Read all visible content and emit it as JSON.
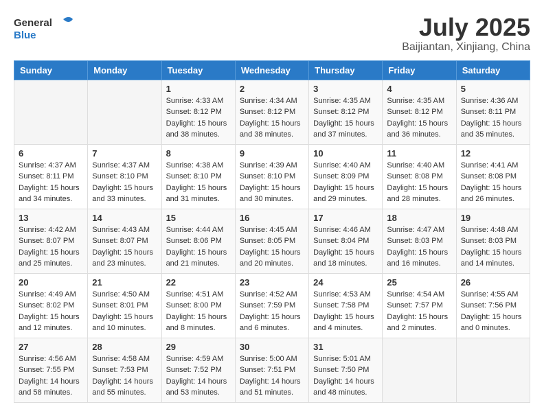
{
  "header": {
    "logo": {
      "general": "General",
      "blue": "Blue"
    },
    "title": "July 2025",
    "subtitle": "Baijiantan, Xinjiang, China"
  },
  "calendar": {
    "weekdays": [
      "Sunday",
      "Monday",
      "Tuesday",
      "Wednesday",
      "Thursday",
      "Friday",
      "Saturday"
    ],
    "weeks": [
      [
        {
          "day": "",
          "sunrise": "",
          "sunset": "",
          "daylight": ""
        },
        {
          "day": "",
          "sunrise": "",
          "sunset": "",
          "daylight": ""
        },
        {
          "day": "1",
          "sunrise": "Sunrise: 4:33 AM",
          "sunset": "Sunset: 8:12 PM",
          "daylight": "Daylight: 15 hours and 38 minutes."
        },
        {
          "day": "2",
          "sunrise": "Sunrise: 4:34 AM",
          "sunset": "Sunset: 8:12 PM",
          "daylight": "Daylight: 15 hours and 38 minutes."
        },
        {
          "day": "3",
          "sunrise": "Sunrise: 4:35 AM",
          "sunset": "Sunset: 8:12 PM",
          "daylight": "Daylight: 15 hours and 37 minutes."
        },
        {
          "day": "4",
          "sunrise": "Sunrise: 4:35 AM",
          "sunset": "Sunset: 8:12 PM",
          "daylight": "Daylight: 15 hours and 36 minutes."
        },
        {
          "day": "5",
          "sunrise": "Sunrise: 4:36 AM",
          "sunset": "Sunset: 8:11 PM",
          "daylight": "Daylight: 15 hours and 35 minutes."
        }
      ],
      [
        {
          "day": "6",
          "sunrise": "Sunrise: 4:37 AM",
          "sunset": "Sunset: 8:11 PM",
          "daylight": "Daylight: 15 hours and 34 minutes."
        },
        {
          "day": "7",
          "sunrise": "Sunrise: 4:37 AM",
          "sunset": "Sunset: 8:10 PM",
          "daylight": "Daylight: 15 hours and 33 minutes."
        },
        {
          "day": "8",
          "sunrise": "Sunrise: 4:38 AM",
          "sunset": "Sunset: 8:10 PM",
          "daylight": "Daylight: 15 hours and 31 minutes."
        },
        {
          "day": "9",
          "sunrise": "Sunrise: 4:39 AM",
          "sunset": "Sunset: 8:10 PM",
          "daylight": "Daylight: 15 hours and 30 minutes."
        },
        {
          "day": "10",
          "sunrise": "Sunrise: 4:40 AM",
          "sunset": "Sunset: 8:09 PM",
          "daylight": "Daylight: 15 hours and 29 minutes."
        },
        {
          "day": "11",
          "sunrise": "Sunrise: 4:40 AM",
          "sunset": "Sunset: 8:08 PM",
          "daylight": "Daylight: 15 hours and 28 minutes."
        },
        {
          "day": "12",
          "sunrise": "Sunrise: 4:41 AM",
          "sunset": "Sunset: 8:08 PM",
          "daylight": "Daylight: 15 hours and 26 minutes."
        }
      ],
      [
        {
          "day": "13",
          "sunrise": "Sunrise: 4:42 AM",
          "sunset": "Sunset: 8:07 PM",
          "daylight": "Daylight: 15 hours and 25 minutes."
        },
        {
          "day": "14",
          "sunrise": "Sunrise: 4:43 AM",
          "sunset": "Sunset: 8:07 PM",
          "daylight": "Daylight: 15 hours and 23 minutes."
        },
        {
          "day": "15",
          "sunrise": "Sunrise: 4:44 AM",
          "sunset": "Sunset: 8:06 PM",
          "daylight": "Daylight: 15 hours and 21 minutes."
        },
        {
          "day": "16",
          "sunrise": "Sunrise: 4:45 AM",
          "sunset": "Sunset: 8:05 PM",
          "daylight": "Daylight: 15 hours and 20 minutes."
        },
        {
          "day": "17",
          "sunrise": "Sunrise: 4:46 AM",
          "sunset": "Sunset: 8:04 PM",
          "daylight": "Daylight: 15 hours and 18 minutes."
        },
        {
          "day": "18",
          "sunrise": "Sunrise: 4:47 AM",
          "sunset": "Sunset: 8:03 PM",
          "daylight": "Daylight: 15 hours and 16 minutes."
        },
        {
          "day": "19",
          "sunrise": "Sunrise: 4:48 AM",
          "sunset": "Sunset: 8:03 PM",
          "daylight": "Daylight: 15 hours and 14 minutes."
        }
      ],
      [
        {
          "day": "20",
          "sunrise": "Sunrise: 4:49 AM",
          "sunset": "Sunset: 8:02 PM",
          "daylight": "Daylight: 15 hours and 12 minutes."
        },
        {
          "day": "21",
          "sunrise": "Sunrise: 4:50 AM",
          "sunset": "Sunset: 8:01 PM",
          "daylight": "Daylight: 15 hours and 10 minutes."
        },
        {
          "day": "22",
          "sunrise": "Sunrise: 4:51 AM",
          "sunset": "Sunset: 8:00 PM",
          "daylight": "Daylight: 15 hours and 8 minutes."
        },
        {
          "day": "23",
          "sunrise": "Sunrise: 4:52 AM",
          "sunset": "Sunset: 7:59 PM",
          "daylight": "Daylight: 15 hours and 6 minutes."
        },
        {
          "day": "24",
          "sunrise": "Sunrise: 4:53 AM",
          "sunset": "Sunset: 7:58 PM",
          "daylight": "Daylight: 15 hours and 4 minutes."
        },
        {
          "day": "25",
          "sunrise": "Sunrise: 4:54 AM",
          "sunset": "Sunset: 7:57 PM",
          "daylight": "Daylight: 15 hours and 2 minutes."
        },
        {
          "day": "26",
          "sunrise": "Sunrise: 4:55 AM",
          "sunset": "Sunset: 7:56 PM",
          "daylight": "Daylight: 15 hours and 0 minutes."
        }
      ],
      [
        {
          "day": "27",
          "sunrise": "Sunrise: 4:56 AM",
          "sunset": "Sunset: 7:55 PM",
          "daylight": "Daylight: 14 hours and 58 minutes."
        },
        {
          "day": "28",
          "sunrise": "Sunrise: 4:58 AM",
          "sunset": "Sunset: 7:53 PM",
          "daylight": "Daylight: 14 hours and 55 minutes."
        },
        {
          "day": "29",
          "sunrise": "Sunrise: 4:59 AM",
          "sunset": "Sunset: 7:52 PM",
          "daylight": "Daylight: 14 hours and 53 minutes."
        },
        {
          "day": "30",
          "sunrise": "Sunrise: 5:00 AM",
          "sunset": "Sunset: 7:51 PM",
          "daylight": "Daylight: 14 hours and 51 minutes."
        },
        {
          "day": "31",
          "sunrise": "Sunrise: 5:01 AM",
          "sunset": "Sunset: 7:50 PM",
          "daylight": "Daylight: 14 hours and 48 minutes."
        },
        {
          "day": "",
          "sunrise": "",
          "sunset": "",
          "daylight": ""
        },
        {
          "day": "",
          "sunrise": "",
          "sunset": "",
          "daylight": ""
        }
      ]
    ]
  }
}
